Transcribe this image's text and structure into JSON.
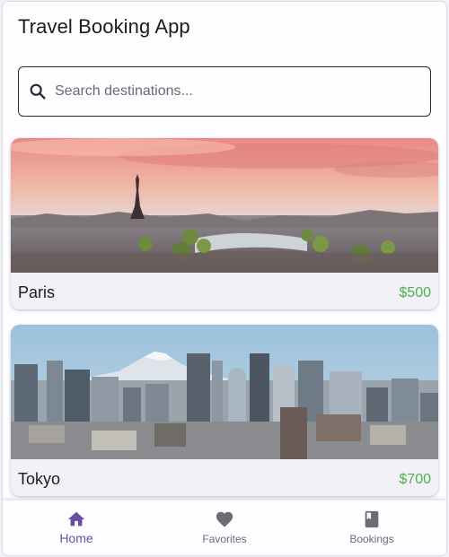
{
  "app": {
    "title": "Travel Booking App"
  },
  "search": {
    "placeholder": "Search destinations..."
  },
  "destinations": [
    {
      "name": "Paris",
      "price": "$500"
    },
    {
      "name": "Tokyo",
      "price": "$700"
    }
  ],
  "nav": {
    "items": [
      {
        "label": "Home",
        "icon": "home-icon",
        "active": true
      },
      {
        "label": "Favorites",
        "icon": "heart-icon",
        "active": false
      },
      {
        "label": "Bookings",
        "icon": "book-icon",
        "active": false
      }
    ]
  },
  "colors": {
    "accent": "#6750a4",
    "price": "#4caf50",
    "text": "#1c1b1f",
    "inactive_nav": "#6f6b75"
  }
}
